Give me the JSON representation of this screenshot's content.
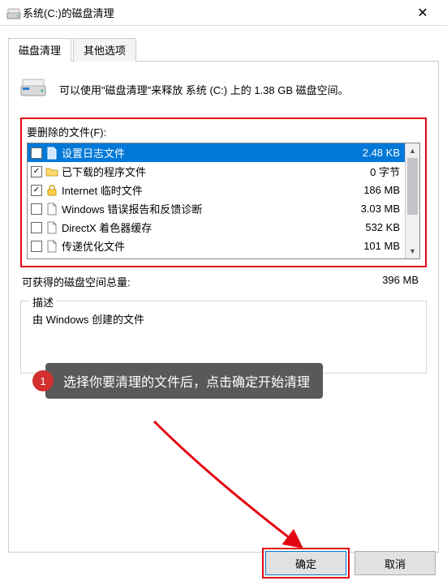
{
  "titlebar": {
    "title": "系统(C:)的磁盘清理"
  },
  "tabs": {
    "cleanup": "磁盘清理",
    "other": "其他选项"
  },
  "info": {
    "text": "可以使用\"磁盘清理\"来释放 系统 (C:) 上的 1.38 GB 磁盘空间。"
  },
  "files_group": {
    "label": "要删除的文件(F):"
  },
  "files": [
    {
      "checked": false,
      "name": "设置日志文件",
      "size": "2.48 KB",
      "icon": "doc",
      "selected": true
    },
    {
      "checked": true,
      "name": "已下载的程序文件",
      "size": "0 字节",
      "icon": "folder"
    },
    {
      "checked": true,
      "name": "Internet 临时文件",
      "size": "186 MB",
      "icon": "lock"
    },
    {
      "checked": false,
      "name": "Windows 错误报告和反馈诊断",
      "size": "3.03 MB",
      "icon": "doc"
    },
    {
      "checked": false,
      "name": "DirectX 着色器缓存",
      "size": "532 KB",
      "icon": "doc"
    },
    {
      "checked": false,
      "name": "传递优化文件",
      "size": "101 MB",
      "icon": "doc"
    }
  ],
  "total": {
    "label": "可获得的磁盘空间总量:",
    "value": "396 MB"
  },
  "description": {
    "legend": "描述",
    "text": "由 Windows 创建的文件"
  },
  "callout": {
    "number": "1",
    "text": "选择你要清理的文件后，点击确定开始清理"
  },
  "buttons": {
    "ok": "确定",
    "cancel": "取消"
  }
}
